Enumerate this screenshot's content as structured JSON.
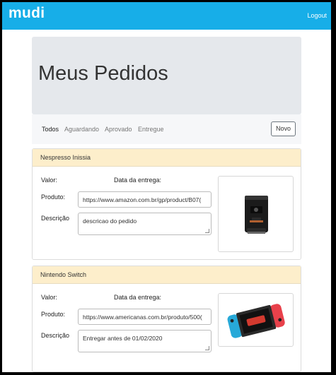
{
  "navbar": {
    "brand": "mudi",
    "logout": "Logout"
  },
  "jumbotron": {
    "title": "Meus Pedidos"
  },
  "filters": {
    "tabs": [
      "Todos",
      "Aguardando",
      "Aprovado",
      "Entregue"
    ],
    "active": "Todos",
    "new_button": "Novo"
  },
  "labels": {
    "valor": "Valor:",
    "data_entrega": "Data da entrega:",
    "produto": "Produto:",
    "descricao": "Descrição"
  },
  "orders": [
    {
      "name": "Nespresso Inissia",
      "product_url": "https://www.amazon.com.br/gp/product/B07(",
      "description": "descricao do pedido",
      "image_icon": "coffee-machine-image"
    },
    {
      "name": "Nintendo Switch",
      "product_url": "https://www.americanas.com.br/produto/500(",
      "description": "Entregar antes de 01/02/2020",
      "image_icon": "game-console-image"
    }
  ],
  "colors": {
    "navbar": "#17aee8",
    "card_header": "#fdeecb",
    "jumbotron": "#e5e8ec"
  }
}
